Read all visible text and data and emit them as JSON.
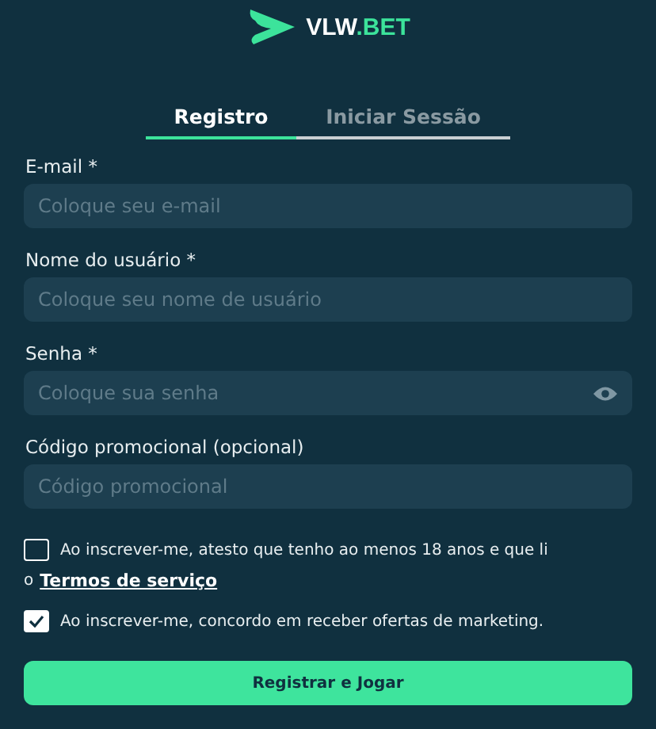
{
  "logo": {
    "name": "VLW",
    "suffix": ".BET"
  },
  "tabs": [
    {
      "label": "Registro",
      "selected": true
    },
    {
      "label": "Iniciar Sessão",
      "selected": false
    }
  ],
  "fields": [
    {
      "label": "E-mail *",
      "placeholder": "Coloque seu e-mail",
      "kind": "text"
    },
    {
      "label": "Nome do usuário *",
      "placeholder": "Coloque seu nome de usuário",
      "kind": "text"
    },
    {
      "label": "Senha *",
      "placeholder": "Coloque sua senha",
      "kind": "password"
    },
    {
      "label": "Código promocional (opcional)",
      "placeholder": "Código promocional",
      "kind": "text"
    }
  ],
  "consents": [
    {
      "lines": [
        "Ao inscrever-me, atesto que tenho ao menos 18 anos e que li",
        "o"
      ],
      "link": "Termos de serviço",
      "checked": false
    },
    {
      "lines": [
        "Ao inscrever-me, concordo em receber ofertas de marketing."
      ],
      "checked": true
    }
  ],
  "submit": "Registrar e Jogar"
}
